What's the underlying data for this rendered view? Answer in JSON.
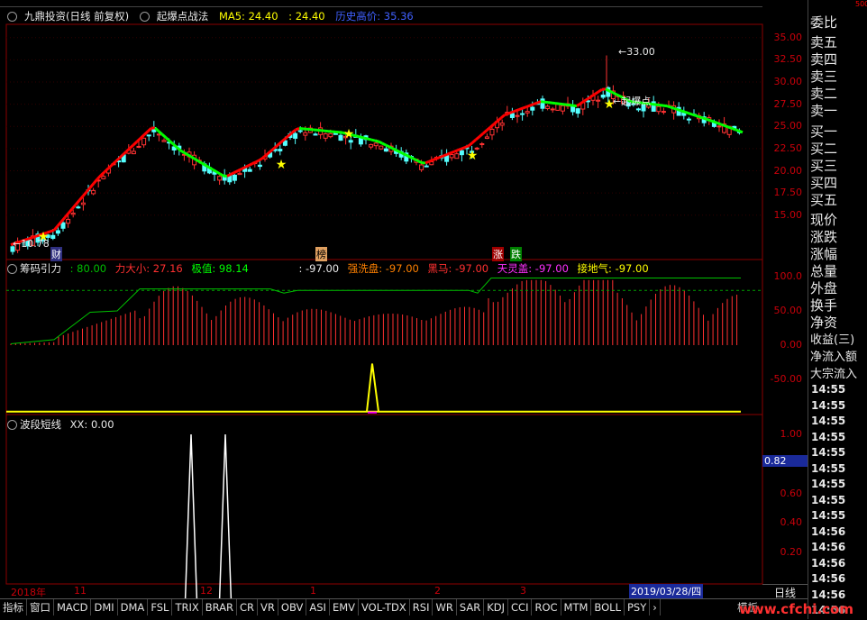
{
  "header": {
    "stock_name": "九鼎投资(日线 前复权)",
    "indicator_name": "起爆点战法",
    "ma5_label": "MA5: 24.40",
    "ma_value2": ": 24.40",
    "hist_high": "历史高价: 35.36"
  },
  "price_axis": {
    "ticks": [
      "35.00",
      "32.50",
      "30.00",
      "27.50",
      "25.00",
      "22.50",
      "20.00",
      "17.50",
      "15.00"
    ]
  },
  "price_annotations": {
    "high_label": "33.00",
    "low_label": "10.78",
    "tag_cai": "财",
    "tag_bang": "榜",
    "tag_zhang": "涨",
    "tag_die": "跌",
    "qibao": "起爆点"
  },
  "panel2": {
    "title": "筹码引力",
    "v1": ": 80.00",
    "l2": "力大小: 27.16",
    "l3": "极值: 98.14",
    "l4": ": -97.00",
    "l5": "强洗盘: -97.00",
    "l6": "黑马: -97.00",
    "l7": "天灵盖: -97.00",
    "l8": "接地气: -97.00",
    "ticks": [
      "100.0",
      "50.00",
      "0.00",
      "-50.00"
    ]
  },
  "panel3": {
    "title": "波段短线",
    "value": "XX: 0.00",
    "ticks": [
      "1.00",
      "0.80",
      "0.60",
      "0.40",
      "0.20"
    ],
    "current": "0.82"
  },
  "date_axis": {
    "labels": [
      "2018年",
      "11",
      "12",
      "1",
      "2",
      "3"
    ],
    "current_date": "2019/03/28/四"
  },
  "tabs": [
    "指标",
    "窗口",
    "MACD",
    "DMI",
    "DMA",
    "FSL",
    "TRIX",
    "BRAR",
    "CR",
    "VR",
    "OBV",
    "ASI",
    "EMV",
    "VOL-TDX",
    "RSI",
    "WR",
    "SAR",
    "KDJ",
    "CCI",
    "ROC",
    "MTM",
    "BOLL",
    "PSY"
  ],
  "tab_right": "模板",
  "period": "日线",
  "right_panel": {
    "ratio_label": "委比",
    "sell": [
      "卖五",
      "卖四",
      "卖三",
      "卖二",
      "卖一"
    ],
    "buy": [
      "买一",
      "买二",
      "买三",
      "买四",
      "买五"
    ],
    "stats": [
      "现价",
      "涨跌",
      "涨幅",
      "总量",
      "外盘",
      "换手",
      "净资",
      "收益(三)",
      "净流入额",
      "大宗流入"
    ],
    "times": [
      "14:55",
      "14:55",
      "14:55",
      "14:55",
      "14:55",
      "14:55",
      "14:55",
      "14:55",
      "14:55",
      "14:56",
      "14:56",
      "14:56",
      "14:56",
      "14:56",
      "14:56",
      "14:56"
    ],
    "top_num": "500"
  },
  "watermark": "www.cfchi.com",
  "colors": {
    "up": "#ff3232",
    "down": "#54ffff",
    "line_red": "#ff0000",
    "line_green": "#00ff00",
    "axis": "#c8000a",
    "yellow": "#ffff00"
  }
}
